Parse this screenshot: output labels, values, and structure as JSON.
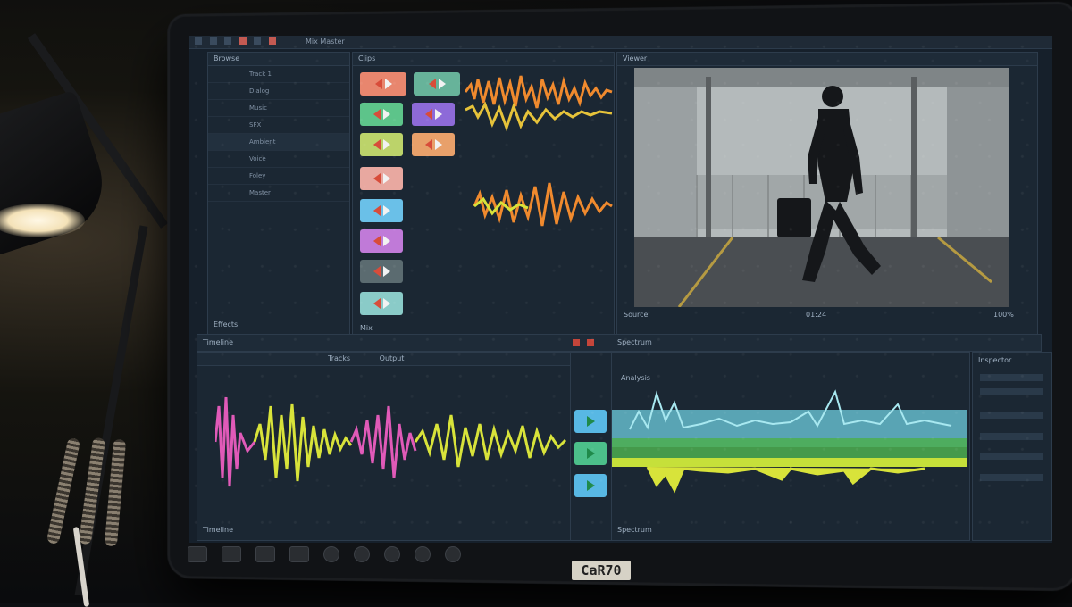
{
  "app": {
    "window_title": "Mix Master"
  },
  "browser": {
    "header_label": "Browse",
    "rows": [
      "Track 1",
      "Dialog",
      "Music",
      "SFX",
      "Ambient",
      "Voice",
      "Foley",
      "Master"
    ],
    "footer_label": "Effects"
  },
  "clip_bin": {
    "header_label": "Clips",
    "footer_label": "Mix"
  },
  "viewer": {
    "header_label": "Viewer",
    "footer_left": "Source",
    "footer_center": "01:24",
    "footer_right": "100%"
  },
  "timeline": {
    "header_label": "Timeline",
    "tab_left": "Tracks",
    "tab_right": "Output",
    "footer_left": "Timeline"
  },
  "spectrum": {
    "header_label": "Spectrum",
    "sub_label": "Analysis",
    "footer_left": "Spectrum"
  },
  "inspector": {
    "header_label": "Inspector"
  },
  "monitor": {
    "sticker_text": "CaR70"
  },
  "colors": {
    "accent_orange": "#f08a2e",
    "accent_yellow": "#d8e33a",
    "accent_pink": "#e05ab8",
    "accent_blue": "#5bb0e0",
    "accent_green": "#4caf50"
  }
}
